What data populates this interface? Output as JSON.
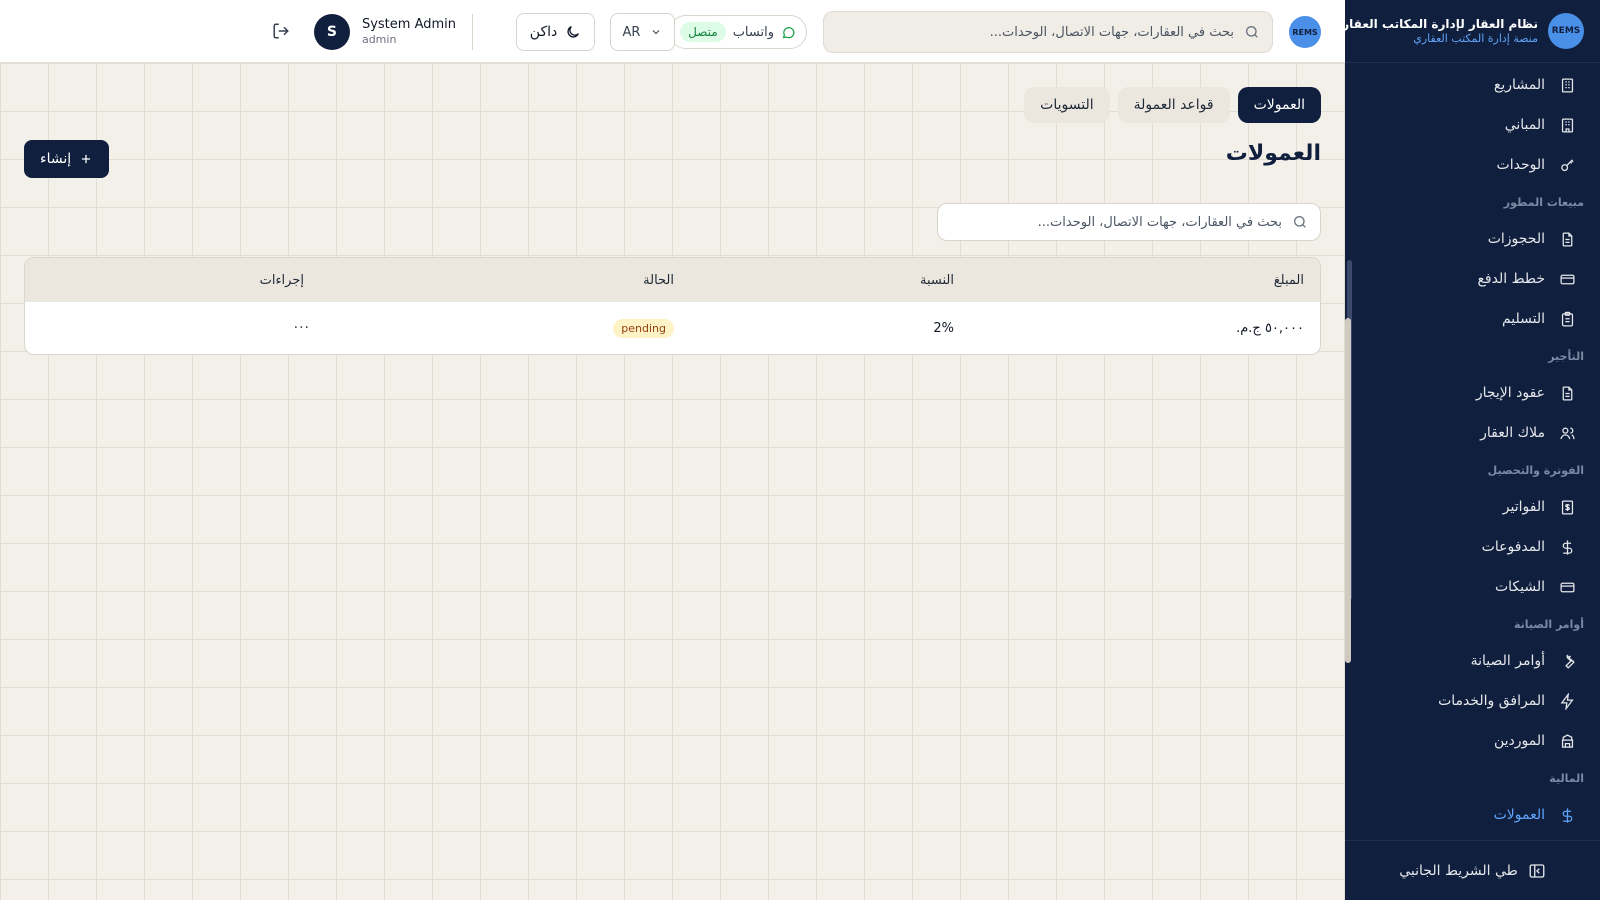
{
  "brand": {
    "logo_text": "REMS",
    "name": "نظام العقار لإدارة المكاتب العقارية",
    "subtitle": "منصة إدارة المكتب العقاري"
  },
  "sidebar": {
    "items": [
      {
        "label": "المشاريع",
        "icon": "building-icon"
      },
      {
        "label": "المباني",
        "icon": "building-icon"
      },
      {
        "label": "الوحدات",
        "icon": "key-icon"
      },
      {
        "section": "مبيعات المطور"
      },
      {
        "label": "الحجوزات",
        "icon": "file-icon"
      },
      {
        "label": "خطط الدفع",
        "icon": "card-icon"
      },
      {
        "label": "التسليم",
        "icon": "clipboard-icon"
      },
      {
        "section": "التأجير"
      },
      {
        "label": "عقود الإيجار",
        "icon": "file-icon"
      },
      {
        "label": "ملاك العقار",
        "icon": "users-icon"
      },
      {
        "section": "الفوترة والتحصيل"
      },
      {
        "label": "الفواتير",
        "icon": "receipt-icon"
      },
      {
        "label": "المدفوعات",
        "icon": "dollar-icon"
      },
      {
        "label": "الشيكات",
        "icon": "card-icon"
      },
      {
        "section": "أوامر الصيانة"
      },
      {
        "label": "أوامر الصيانة",
        "icon": "wrench-icon"
      },
      {
        "label": "المرافق والخدمات",
        "icon": "bolt-icon"
      },
      {
        "label": "الموردين",
        "icon": "store-icon"
      },
      {
        "section": "المالية"
      },
      {
        "label": "العمولات",
        "icon": "dollar-icon",
        "active": true
      }
    ],
    "collapse_label": "طي الشريط الجانبي"
  },
  "topbar": {
    "avatar_text": "REMS",
    "search_placeholder": "بحث في العقارات، جهات الاتصال، الوحدات...",
    "whatsapp_label": "واتساب",
    "whatsapp_status": "متصل",
    "language": "AR",
    "theme_label": "داكن",
    "user_name": "System Admin",
    "user_role": "admin",
    "user_initial": "S"
  },
  "main": {
    "tabs": [
      {
        "label": "العمولات",
        "active": true
      },
      {
        "label": "قواعد العمولة",
        "active": false
      },
      {
        "label": "التسويات",
        "active": false
      }
    ],
    "title": "العمولات",
    "create_label": "إنشاء",
    "search_placeholder": "بحث في العقارات، جهات الاتصال، الوحدات...",
    "table": {
      "headers": [
        "المبلغ",
        "النسبة",
        "الحالة",
        "إجراءات"
      ],
      "rows": [
        {
          "amount": "٥٠,٠٠٠ ج.م.",
          "rate": "2%",
          "status": "pending",
          "actions": "···"
        }
      ]
    }
  },
  "colors": {
    "sidebar_bg": "#0f1f3d",
    "accent": "#60a5fa",
    "primary_button": "#0f1f3d",
    "pending_badge": "#fef3c7",
    "connected_badge": "#dcfce7"
  }
}
